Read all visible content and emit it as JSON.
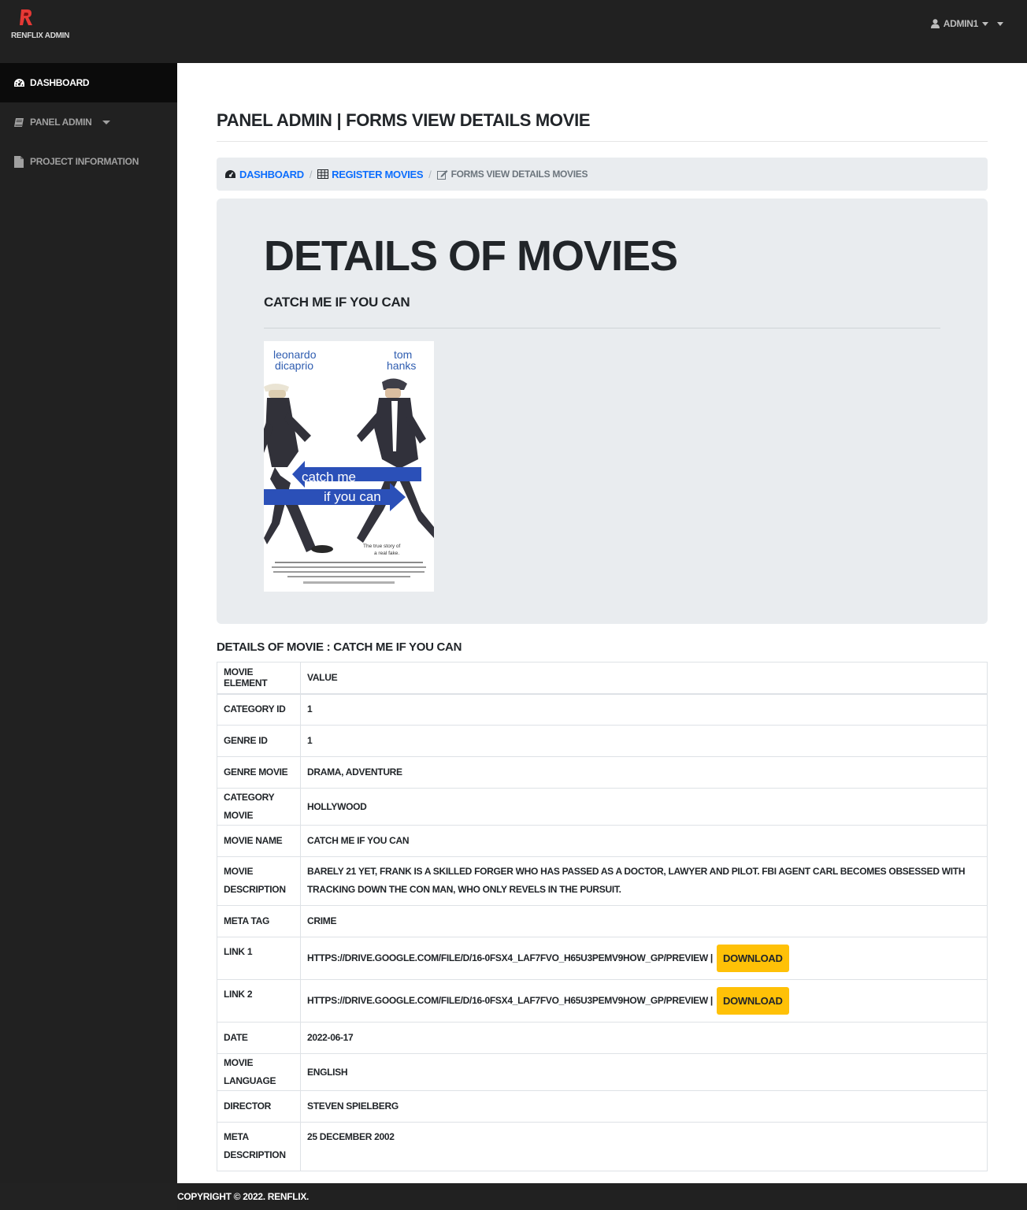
{
  "brand": {
    "name": "RENFLIX ADMIN",
    "logo_color": "#e53935"
  },
  "user": {
    "name": "ADMIN1"
  },
  "sidebar": {
    "items": [
      {
        "label": "DASHBOARD",
        "icon": "tachometer-icon",
        "active": true
      },
      {
        "label": "PANEL ADMIN",
        "icon": "book-icon",
        "active": false
      },
      {
        "label": "PROJECT INFORMATION",
        "icon": "file-icon",
        "active": false
      }
    ]
  },
  "page": {
    "title": "PANEL ADMIN | FORMS VIEW DETAILS MOVIE"
  },
  "breadcrumb": {
    "items": [
      {
        "label": "DASHBOARD",
        "icon": "tachometer-icon"
      },
      {
        "label": "REGISTER MOVIES",
        "icon": "table-icon"
      },
      {
        "label": "FORMS VIEW DETAILS MOVIES",
        "icon": "edit-icon"
      }
    ]
  },
  "jumbotron": {
    "title": "DETAILS OF MOVIES",
    "subtitle": "CATCH ME IF YOU CAN",
    "poster": {
      "actor_left_1": "leonardo",
      "actor_left_2": "dicaprio",
      "actor_right_1": "tom",
      "actor_right_2": "hanks",
      "title_1": "catch me",
      "title_2": "if you can",
      "tagline_1": "The true story of",
      "tagline_2": "a real fake."
    }
  },
  "details": {
    "caption": "DETAILS OF MOVIE : CATCH ME IF YOU CAN",
    "headers": [
      "MOVIE ELEMENT",
      "VALUE"
    ],
    "rows": [
      {
        "label": "CATEGORY ID",
        "value": "1"
      },
      {
        "label": "GENRE ID",
        "value": "1"
      },
      {
        "label": "GENRE MOVIE",
        "value": "DRAMA, ADVENTURE"
      },
      {
        "label": "CATEGORY MOVIE",
        "value": "HOLLYWOOD"
      },
      {
        "label": "MOVIE NAME",
        "value": "CATCH ME IF YOU CAN"
      },
      {
        "label": "MOVIE DESCRIPTION",
        "value": "BARELY 21 YET, FRANK IS A SKILLED FORGER WHO HAS PASSED AS A DOCTOR, LAWYER AND PILOT. FBI AGENT CARL BECOMES OBSESSED WITH TRACKING DOWN THE CON MAN, WHO ONLY REVELS IN THE PURSUIT."
      },
      {
        "label": "META TAG",
        "value": "CRIME"
      },
      {
        "label": "LINK 1",
        "value": "HTTPS://DRIVE.GOOGLE.COM/FILE/D/16-0FSX4_LAF7FVO_H65U3PEMV9HOW_GP/PREVIEW |",
        "button": "DOWNLOAD"
      },
      {
        "label": "LINK 2",
        "value": "HTTPS://DRIVE.GOOGLE.COM/FILE/D/16-0FSX4_LAF7FVO_H65U3PEMV9HOW_GP/PREVIEW |",
        "button": "DOWNLOAD"
      },
      {
        "label": "DATE",
        "value": "2022-06-17"
      },
      {
        "label": "MOVIE LANGUAGE",
        "value": "ENGLISH"
      },
      {
        "label": "DIRECTOR",
        "value": "STEVEN SPIELBERG"
      },
      {
        "label": "META DESCRIPTION",
        "value": "25 DECEMBER 2002"
      }
    ]
  },
  "footer": {
    "text": "COPYRIGHT © 2022. RENFLIX."
  },
  "colors": {
    "link": "#0d6efd",
    "download_button": "#ffc107",
    "sidebar_bg": "#212121"
  }
}
